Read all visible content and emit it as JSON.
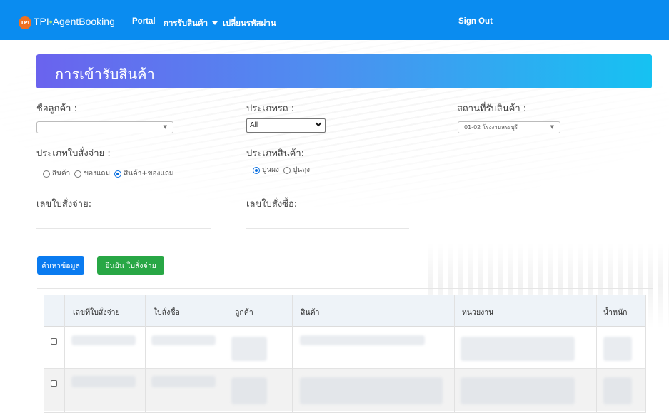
{
  "navbar": {
    "logo_text": "TPI",
    "brand_main": "TPI",
    "brand_dot": "•",
    "brand_rest": "AgentBooking",
    "items": [
      {
        "label": "Portal"
      },
      {
        "label": "การรับสินค้า"
      },
      {
        "label": "เปลี่ยนรหัสผ่าน"
      }
    ],
    "sign_out": "Sign Out"
  },
  "banner": {
    "title": "การเข้ารับสินค้า"
  },
  "form": {
    "customer_name_label": "ชื่อลูกค้า :",
    "customer_name_value": "",
    "vehicle_type_label": "ประเภทรถ :",
    "vehicle_type_value": "All",
    "pickup_location_label": "สถานที่รับสินค้า :",
    "pickup_location_value": "01-02 โรงงานสระบุรี",
    "order_type_label": "ประเภทใบสั่งจ่าย :",
    "order_type_options": [
      "สินค้า",
      "ของแถม",
      "สินค้า+ของแถม"
    ],
    "order_type_selected": "สินค้า+ของแถม",
    "product_type_label": "ประเภทสินค้า:",
    "product_type_options": [
      "ปูนผง",
      "ปูนถุง"
    ],
    "product_type_selected": "ปูนผง",
    "order_no_label": "เลขใบสั่งจ่าย:",
    "po_no_label": "เลขใบสั่งซื้อ:"
  },
  "buttons": {
    "search": "ค้นหาข้อมูล",
    "confirm": "ยืนยัน ใบสั่งจ่าย"
  },
  "table": {
    "columns": [
      "เลขที่ใบสั่งจ่าย",
      "ใบสั่งซื้อ",
      "ลูกค้า",
      "สินค้า",
      "หน่วยงาน",
      "น้ำหนัก"
    ]
  },
  "colors": {
    "navbar": "#0a8cf0",
    "banner_start": "#6a63ee",
    "banner_end": "#16c2f2",
    "primary_button": "#0a7bf0",
    "success_button": "#28a745"
  }
}
